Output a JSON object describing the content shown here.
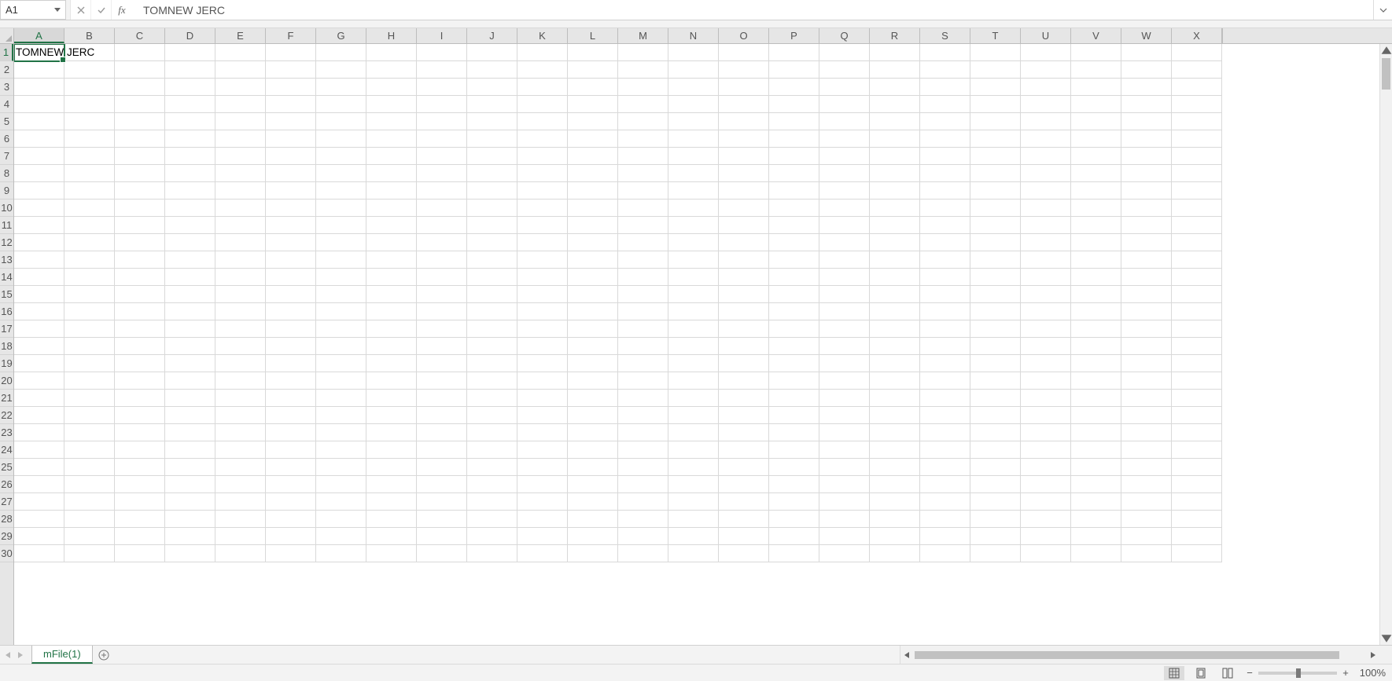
{
  "name_box": {
    "value": "A1"
  },
  "formula_bar": {
    "value": "TOMNEW JERC",
    "fx_label": "fx"
  },
  "columns": [
    "A",
    "B",
    "C",
    "D",
    "E",
    "F",
    "G",
    "H",
    "I",
    "J",
    "K",
    "L",
    "M",
    "N",
    "O",
    "P",
    "Q",
    "R",
    "S",
    "T",
    "U",
    "V",
    "W",
    "X"
  ],
  "active_column_index": 0,
  "rows": [
    "1",
    "2",
    "3",
    "4",
    "5",
    "6",
    "7",
    "8",
    "9",
    "10",
    "11",
    "12",
    "13",
    "14",
    "15",
    "16",
    "17",
    "18",
    "19",
    "20",
    "21",
    "22",
    "23",
    "24",
    "25",
    "26",
    "27",
    "28",
    "29",
    "30"
  ],
  "active_row_index": 0,
  "cells": {
    "A1": "TOMNEW JERC"
  },
  "selected_cell": "A1",
  "sheet_tabs": {
    "active": "mFile(1)"
  },
  "status": {
    "zoom_percent": "100%"
  }
}
